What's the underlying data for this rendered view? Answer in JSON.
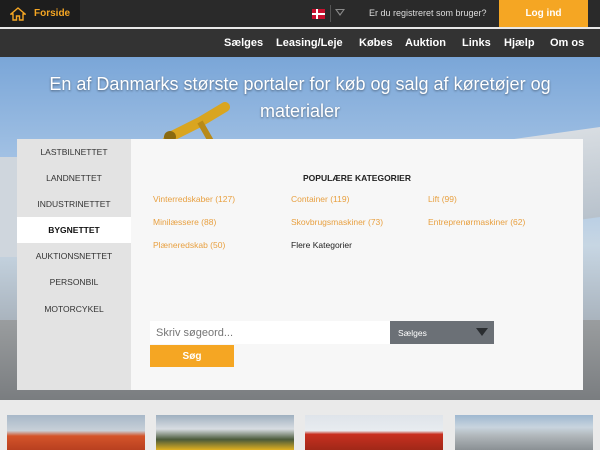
{
  "topbar": {
    "home_label": "Forside",
    "registered_text": "Er du registreret som bruger?",
    "login_label": "Log ind",
    "flag_icon": "danish-flag-icon",
    "accent": "#f5a623"
  },
  "nav": {
    "items": [
      {
        "label": "Sælges"
      },
      {
        "label": "Leasing/Leje"
      },
      {
        "label": "Købes"
      },
      {
        "label": "Auktion"
      },
      {
        "label": "Links"
      },
      {
        "label": "Hjælp"
      },
      {
        "label": "Om os"
      }
    ]
  },
  "hero": {
    "title_line1": "En af Danmarks største portaler for køb og salg af køretøjer og",
    "title_line2": "materialer"
  },
  "sidebar": {
    "items": [
      {
        "label": "LASTBILNETTET",
        "active": false
      },
      {
        "label": "LANDNETTET",
        "active": false
      },
      {
        "label": "INDUSTRINETTET",
        "active": false
      },
      {
        "label": "BYGNETTET",
        "active": true
      },
      {
        "label": "AUKTIONSNETTET",
        "active": false
      },
      {
        "label": "PERSONBIL",
        "active": false
      },
      {
        "label": "MOTORCYKEL",
        "active": false
      }
    ]
  },
  "categories": {
    "heading": "POPULÆRE KATEGORIER",
    "links": [
      {
        "label": "Vinterredskaber (127)"
      },
      {
        "label": "Container (119)"
      },
      {
        "label": "Lift (99)"
      },
      {
        "label": "Minilæssere (88)"
      },
      {
        "label": "Skovbrugsmaskiner (73)"
      },
      {
        "label": "Entreprenørmaskiner (62)"
      },
      {
        "label": "Plæneredskab (50)"
      },
      {
        "label": "Flere Kategorier"
      }
    ],
    "link_color": "#e8a040"
  },
  "search": {
    "placeholder": "Skriv søgeord...",
    "select_value": "Sælges",
    "button_label": "Søg"
  },
  "thumbnails": [
    {
      "name": "orange-machine-thumb"
    },
    {
      "name": "building-vehicles-thumb"
    },
    {
      "name": "red-trailer-thumb"
    },
    {
      "name": "container-thumb"
    }
  ]
}
